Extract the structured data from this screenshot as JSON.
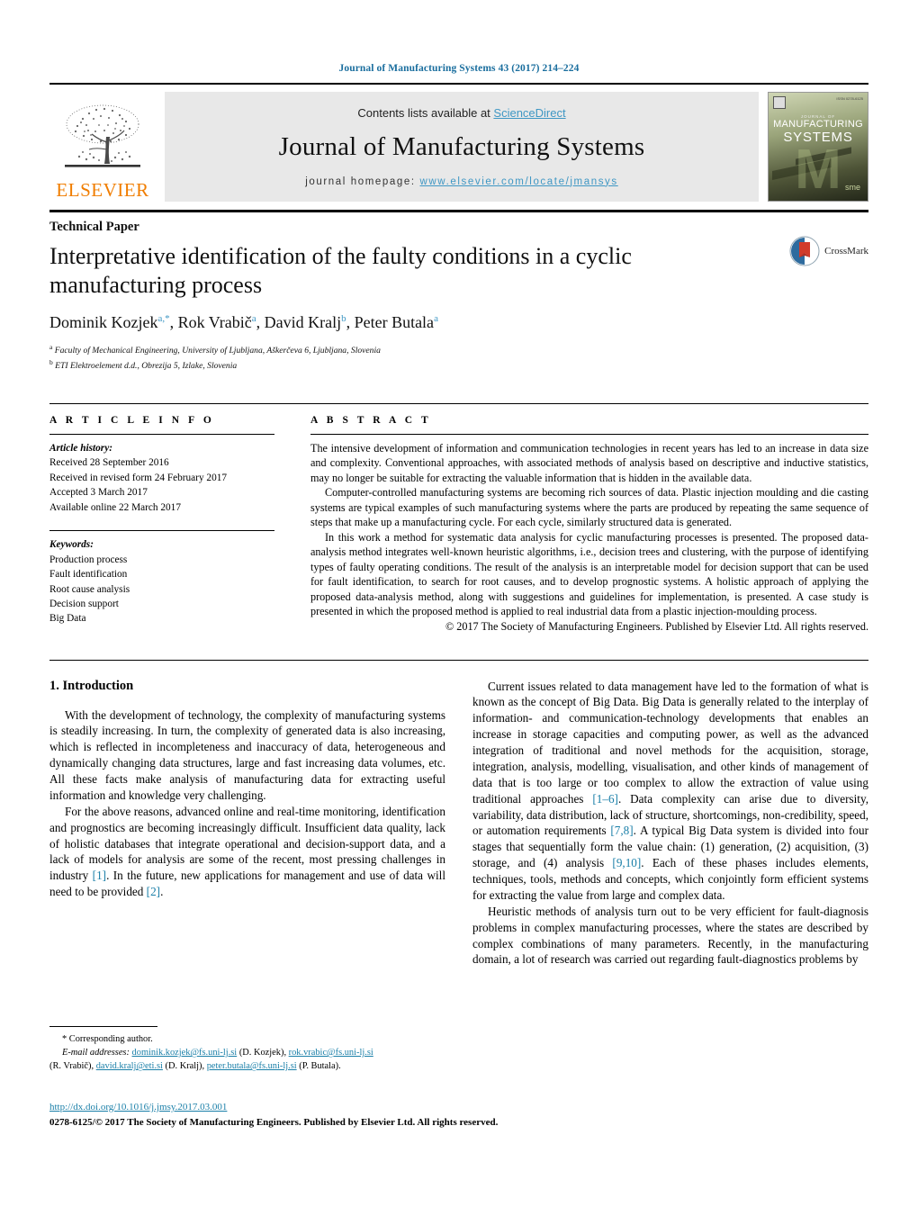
{
  "running_head": "Journal of Manufacturing Systems 43 (2017) 214–224",
  "masthead": {
    "publisher": "ELSEVIER",
    "contents_prefix": "Contents lists available at ",
    "contents_link": "ScienceDirect",
    "journal_title": "Journal of Manufacturing Systems",
    "homepage_prefix": "journal homepage: ",
    "homepage_url": "www.elsevier.com/locate/jmansys",
    "cover": {
      "kicker": "JOURNAL OF",
      "line1": "MANUFACTURING",
      "line2": "SYSTEMS",
      "issn": "ISSN 0278-6125",
      "sme": "sme"
    },
    "link_color": "#3f97c4",
    "brand_color": "#f07d00"
  },
  "article": {
    "type": "Technical Paper",
    "title": "Interpretative identification of the faulty conditions in a cyclic manufacturing process",
    "authors_html": "Dominik Kozjek, Rok Vrabič, David Kralj, Peter Butala",
    "authors": [
      {
        "name": "Dominik Kozjek",
        "sup": "a,*"
      },
      {
        "name": "Rok Vrabič",
        "sup": "a"
      },
      {
        "name": "David Kralj",
        "sup": "b"
      },
      {
        "name": "Peter Butala",
        "sup": "a"
      }
    ],
    "affiliations": [
      {
        "marker": "a",
        "text": "Faculty of Mechanical Engineering, University of Ljubljana, Aškerčeva 6, Ljubljana, Slovenia"
      },
      {
        "marker": "b",
        "text": "ETI Elektroelement d.d., Obrezija 5, Izlake, Slovenia"
      }
    ],
    "crossmark_label": "CrossMark"
  },
  "article_info": {
    "heading": "A R T I C L E    I N F O",
    "history_title": "Article history:",
    "history": [
      "Received 28 September 2016",
      "Received in revised form 24 February 2017",
      "Accepted 3 March 2017",
      "Available online 22 March 2017"
    ],
    "keywords_title": "Keywords:",
    "keywords": [
      "Production process",
      "Fault identification",
      "Root cause analysis",
      "Decision support",
      "Big Data"
    ]
  },
  "abstract": {
    "heading": "A B S T R A C T",
    "paragraphs": [
      "The intensive development of information and communication technologies in recent years has led to an increase in data size and complexity. Conventional approaches, with associated methods of analysis based on descriptive and inductive statistics, may no longer be suitable for extracting the valuable information that is hidden in the available data.",
      "Computer-controlled manufacturing systems are becoming rich sources of data. Plastic injection moulding and die casting systems are typical examples of such manufacturing systems where the parts are produced by repeating the same sequence of steps that make up a manufacturing cycle. For each cycle, similarly structured data is generated.",
      "In this work a method for systematic data analysis for cyclic manufacturing processes is presented. The proposed data-analysis method integrates well-known heuristic algorithms, i.e., decision trees and clustering, with the purpose of identifying types of faulty operating conditions. The result of the analysis is an interpretable model for decision support that can be used for fault identification, to search for root causes, and to develop prognostic systems. A holistic approach of applying the proposed data-analysis method, along with suggestions and guidelines for implementation, is presented. A case study is presented in which the proposed method is applied to real industrial data from a plastic injection-moulding process."
    ],
    "copyright": "© 2017 The Society of Manufacturing Engineers. Published by Elsevier Ltd. All rights reserved."
  },
  "body": {
    "section_number_title": "1.  Introduction",
    "left_paragraphs": [
      "With the development of technology, the complexity of manufacturing systems is steadily increasing. In turn, the complexity of generated data is also increasing, which is reflected in incompleteness and inaccuracy of data, heterogeneous and dynamically changing data structures, large and fast increasing data volumes, etc. All these facts make analysis of manufacturing data for extracting useful information and knowledge very challenging.",
      "For the above reasons, advanced online and real-time monitoring, identification and prognostics are becoming increasingly difficult. Insufficient data quality, lack of holistic databases that integrate operational and decision-support data, and a lack of models for analysis are some of the recent, most pressing challenges in industry [1]. In the future, new applications for management and use of data will need to be provided [2]."
    ],
    "right_paragraphs": [
      "Current issues related to data management have led to the formation of what is known as the concept of Big Data. Big Data is generally related to the interplay of information- and communication-technology developments that enables an increase in storage capacities and computing power, as well as the advanced integration of traditional and novel methods for the acquisition, storage, integration, analysis, modelling, visualisation, and other kinds of management of data that is too large or too complex to allow the extraction of value using traditional approaches [1–6]. Data complexity can arise due to diversity, variability, data distribution, lack of structure, shortcomings, non-credibility, speed, or automation requirements [7,8]. A typical Big Data system is divided into four stages that sequentially form the value chain: (1) generation, (2) acquisition, (3) storage, and (4) analysis [9,10]. Each of these phases includes elements, techniques, tools, methods and concepts, which conjointly form efficient systems for extracting the value from large and complex data.",
      "Heuristic methods of analysis turn out to be very efficient for fault-diagnosis problems in complex manufacturing processes, where the states are described by complex combinations of many parameters. Recently, in the manufacturing domain, a lot of research was carried out regarding fault-diagnostics problems by"
    ],
    "citation_color": "#1a7fa8"
  },
  "footnote": {
    "corresponding": "* Corresponding author.",
    "email_label": "E-mail addresses:",
    "emails": [
      {
        "address": "dominik.kozjek@fs.uni-lj.si",
        "owner": "(D. Kozjek)"
      },
      {
        "address": "rok.vrabic@fs.uni-lj.si",
        "owner": "(R. Vrabič)"
      },
      {
        "address": "david.kralj@eti.si",
        "owner": "(D. Kralj)"
      },
      {
        "address": "peter.butala@fs.uni-lj.si",
        "owner": "(P. Butala)"
      }
    ]
  },
  "bottom": {
    "doi": "http://dx.doi.org/10.1016/j.jmsy.2017.03.001",
    "issn_copyright": "0278-6125/© 2017 The Society of Manufacturing Engineers. Published by Elsevier Ltd. All rights reserved."
  }
}
